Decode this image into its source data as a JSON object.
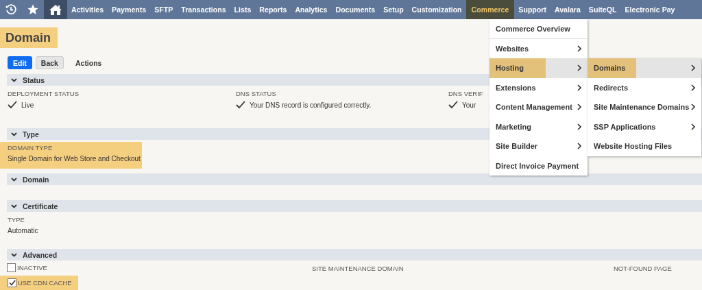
{
  "nav": {
    "items": [
      {
        "label": "Activities",
        "selected": false
      },
      {
        "label": "Payments",
        "selected": false
      },
      {
        "label": "SFTP",
        "selected": false
      },
      {
        "label": "Transactions",
        "selected": false
      },
      {
        "label": "Lists",
        "selected": false
      },
      {
        "label": "Reports",
        "selected": false
      },
      {
        "label": "Analytics",
        "selected": false
      },
      {
        "label": "Documents",
        "selected": false
      },
      {
        "label": "Setup",
        "selected": false
      },
      {
        "label": "Customization",
        "selected": false
      },
      {
        "label": "Commerce",
        "selected": true
      },
      {
        "label": "Support",
        "selected": false
      },
      {
        "label": "Avalara",
        "selected": false
      },
      {
        "label": "SuiteQL",
        "selected": false
      },
      {
        "label": "Electronic Pay",
        "selected": false
      }
    ]
  },
  "page_title": {
    "text": "Domain",
    "highlighted": true
  },
  "buttons": [
    {
      "label": "Edit",
      "kind": "primary"
    },
    {
      "label": "Back",
      "kind": "secondary"
    },
    {
      "label": "Actions",
      "kind": "menu"
    }
  ],
  "sections": [
    {
      "title": "Status",
      "expanded": true,
      "fields": [
        {
          "kind": "status",
          "label": "DEPLOYMENT STATUS",
          "value": "Live",
          "highlighted": false
        },
        {
          "kind": "status",
          "label": "DNS STATUS",
          "value": "Your DNS record is configured correctly.",
          "highlighted": false
        },
        {
          "kind": "status",
          "label": "DNS VERIF",
          "value": "Your",
          "highlighted": false
        }
      ]
    },
    {
      "title": "Type",
      "expanded": true,
      "fields": [
        {
          "kind": "text",
          "label": "DOMAIN TYPE",
          "value": "Single Domain for Web Store and Checkout",
          "highlighted": true
        }
      ]
    },
    {
      "title": "Domain",
      "expanded": true
    },
    {
      "title": "Certificate",
      "expanded": true,
      "fields": [
        {
          "kind": "text",
          "label": "TYPE",
          "value": "Automatic",
          "highlighted": false
        }
      ]
    },
    {
      "title": "Advanced",
      "expanded": true,
      "fields": [
        {
          "kind": "checkbox",
          "label": "INACTIVE",
          "checked": false,
          "highlighted": false
        },
        {
          "kind": "label",
          "label": "SITE MAINTENANCE DOMAIN"
        },
        {
          "kind": "label",
          "label": "NOT-FOUND PAGE"
        },
        {
          "kind": "checkbox",
          "label": "USE CDN CACHE",
          "checked": true,
          "highlighted": true
        }
      ]
    }
  ],
  "menu": {
    "items": [
      {
        "label": "Commerce Overview",
        "has_submenu": false,
        "selected": false,
        "highlighted": false
      },
      {
        "label": "Websites",
        "has_submenu": true,
        "selected": false,
        "highlighted": false
      },
      {
        "label": "Hosting",
        "has_submenu": true,
        "selected": true,
        "highlighted": true
      },
      {
        "label": "Extensions",
        "has_submenu": true,
        "selected": false,
        "highlighted": false
      },
      {
        "label": "Content Management",
        "has_submenu": true,
        "selected": false,
        "highlighted": false
      },
      {
        "label": "Marketing",
        "has_submenu": true,
        "selected": false,
        "highlighted": false
      },
      {
        "label": "Site Builder",
        "has_submenu": true,
        "selected": false,
        "highlighted": false
      },
      {
        "label": "Direct Invoice Payment",
        "has_submenu": false,
        "selected": false,
        "highlighted": false
      }
    ]
  },
  "submenu": {
    "items": [
      {
        "label": "Domains",
        "has_submenu": true,
        "selected": true,
        "highlighted": true
      },
      {
        "label": "Redirects",
        "has_submenu": true,
        "selected": false,
        "highlighted": false
      },
      {
        "label": "Site Maintenance Domains",
        "has_submenu": true,
        "selected": false,
        "highlighted": false
      },
      {
        "label": "SSP Applications",
        "has_submenu": true,
        "selected": false,
        "highlighted": false
      },
      {
        "label": "Website Hosting Files",
        "has_submenu": false,
        "selected": false,
        "highlighted": false
      }
    ]
  }
}
